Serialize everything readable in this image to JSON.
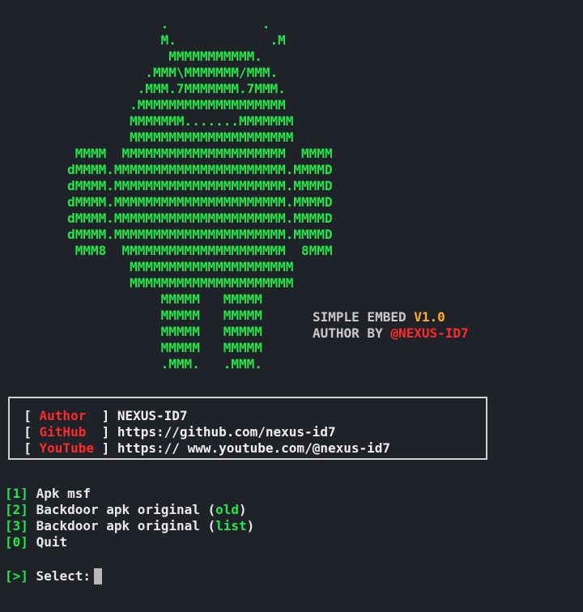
{
  "banner": {
    "ascii_art": [
      "                    .            .",
      "                    M.            .M",
      "                     MMMMMMMMMMM.",
      "                  .MMM\\MMMMMMM/MMM.",
      "                 .MMM.7MMMMMMM.7MMM.",
      "                .MMMMMMMMMMMMMMMMMMM",
      "                MMMMMMM.......MMMMMMM",
      "                MMMMMMMMMMMMMMMMMMMMM",
      "         MMMM  MMMMMMMMMMMMMMMMMMMMM  MMMM",
      "        dMMMM.MMMMMMMMMMMMMMMMMMMMMM.MMMMD",
      "        dMMMM.MMMMMMMMMMMMMMMMMMMMMM.MMMMD",
      "        dMMMM.MMMMMMMMMMMMMMMMMMMMMM.MMMMD",
      "        dMMMM.MMMMMMMMMMMMMMMMMMMMMM.MMMMD",
      "        dMMMM.MMMMMMMMMMMMMMMMMMMMMM.MMMMD",
      "         MMM8  MMMMMMMMMMMMMMMMMMMMM  8MMM",
      "                MMMMMMMMMMMMMMMMMMMMM",
      "                MMMMMMMMMMMMMMMMMMMMM",
      "                    MMMMM   MMMMM",
      "                    MMMMM   MMMMM",
      "                    MMMMM   MMMMM",
      "                    MMMMM   MMMMM",
      "                    .MMM.   .MMM."
    ],
    "title_prefix": "SIMPLE EMBED ",
    "version": "V1.0",
    "author_prefix": "AUTHOR BY ",
    "author_handle": "@NEXUS-ID7"
  },
  "info": {
    "rows": [
      {
        "label": "Author",
        "value": "NEXUS-ID7"
      },
      {
        "label": "GitHub",
        "value": "https://github.com/nexus-id7"
      },
      {
        "label": "YouTube",
        "value": "https:// www.youtube.com/@nexus-id7"
      }
    ]
  },
  "menu": {
    "items": [
      {
        "key": "1",
        "text": "Apk msf",
        "extra": ""
      },
      {
        "key": "2",
        "text": "Backdoor apk original (",
        "extra": "old",
        "close": ")"
      },
      {
        "key": "3",
        "text": "Backdoor apk original (",
        "extra": "list",
        "close": ")"
      },
      {
        "key": "0",
        "text": "Quit",
        "extra": ""
      }
    ]
  },
  "prompt": {
    "marker": "[>]",
    "label": "Select:"
  },
  "colors": {
    "background": "#1f2329",
    "accent_green": "#22e84a",
    "accent_red": "#ff2a2a",
    "accent_orange": "#ffb020"
  }
}
